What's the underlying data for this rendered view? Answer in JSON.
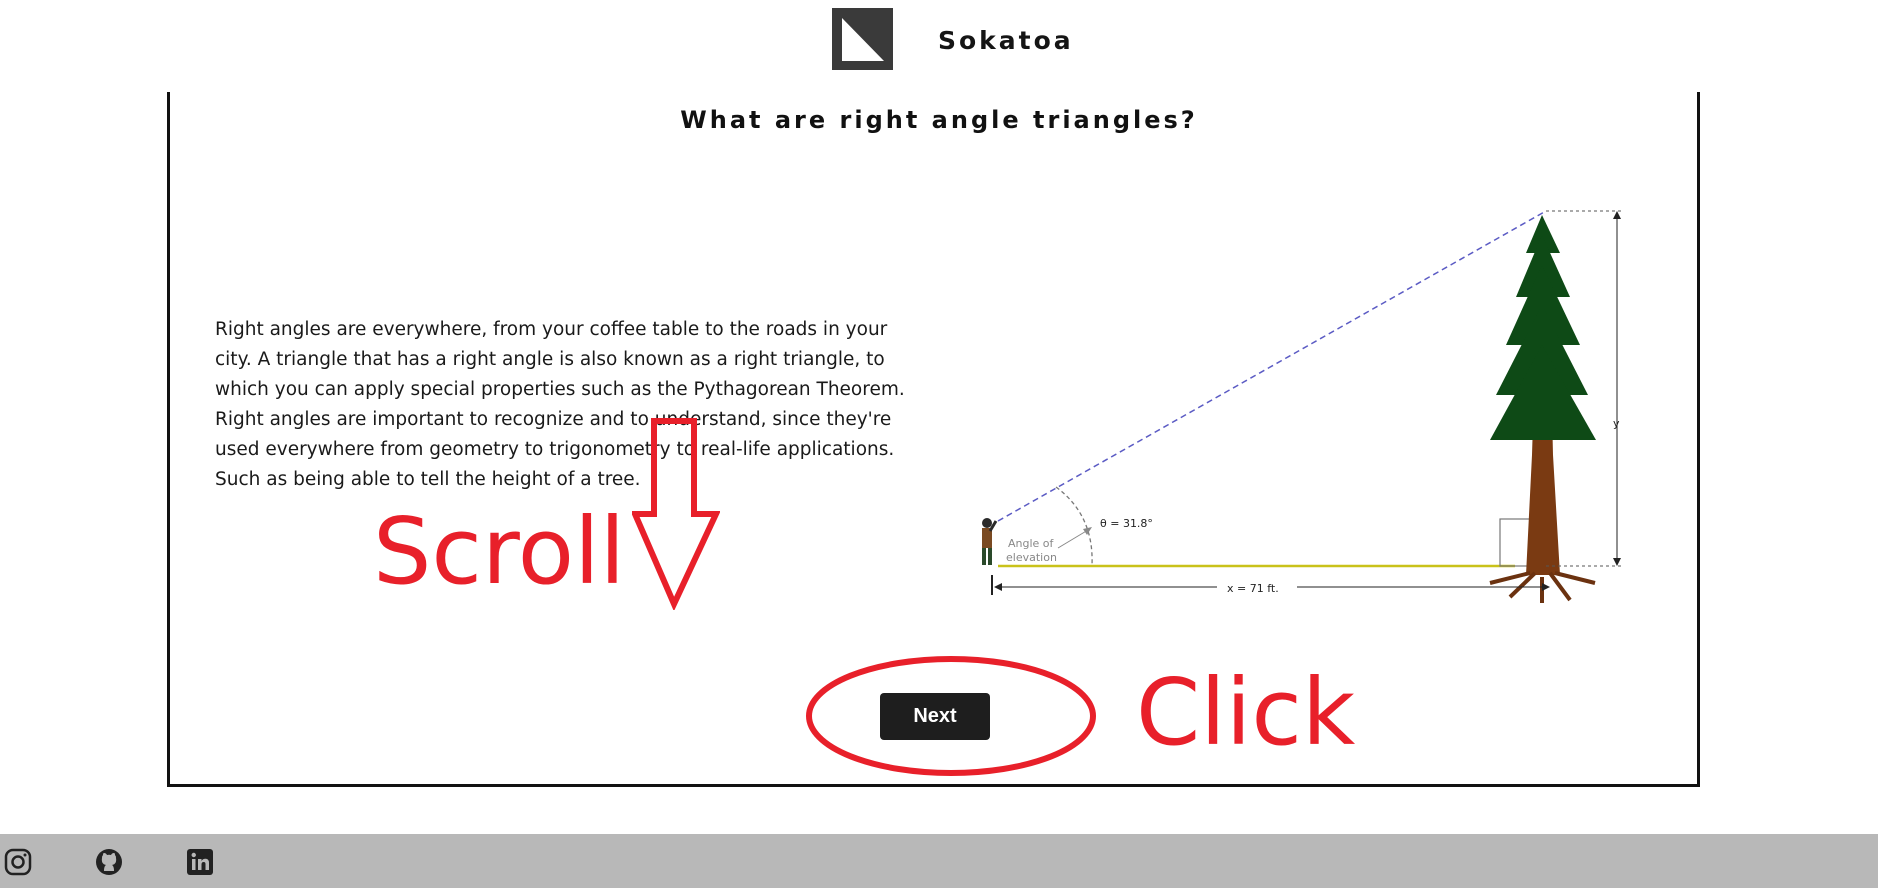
{
  "header": {
    "brand": "Sokatoa",
    "logo_icon": "triangle-logo-icon"
  },
  "main": {
    "title": "What are right angle triangles?",
    "paragraph": "Right angles are everywhere, from your coffee table to the roads in your city. A triangle that has a right angle is also known as a right triangle, to which you can apply special properties such as the Pythagorean Theorem. Right angles are important to recognize and to understand, since they're used everywhere from geometry to trigonometry to real-life applications. Such as being able to tell the height of a tree.",
    "figure": {
      "angle_label": "θ = 31.8°",
      "angle_caption_line1": "Angle of",
      "angle_caption_line2": "elevation",
      "distance_label": "x = 71 ft.",
      "height_label": "y"
    },
    "next_label": "Next"
  },
  "annotations": {
    "scroll": "Scroll",
    "click": "Click",
    "color": "#e8202a"
  },
  "footer": {
    "icons": [
      "instagram-icon",
      "github-icon",
      "linkedin-icon"
    ]
  }
}
